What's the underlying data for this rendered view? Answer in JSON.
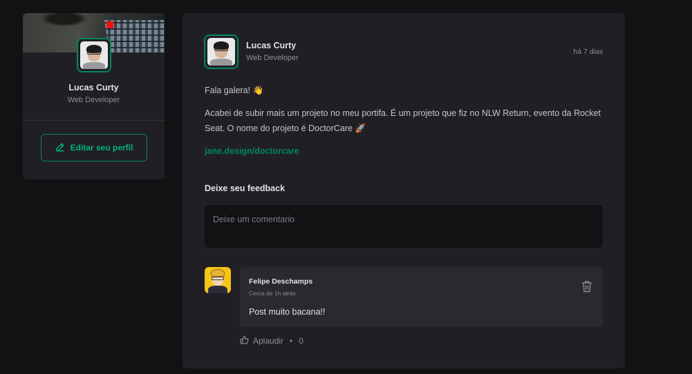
{
  "profile": {
    "name": "Lucas Curty",
    "role": "Web Developer",
    "edit_label": "Editar seu perfil"
  },
  "post": {
    "author_name": "Lucas Curty",
    "author_role": "Web Developer",
    "published": "há 7 dias",
    "paragraph_1": "Fala galera! 👋",
    "paragraph_2": "Acabei de subir mais um projeto no meu portifa. É um projeto que fiz no NLW Return, evento da Rocket Seat. O nome do projeto é DoctorCare 🚀",
    "link": "jane.design/doctorcare"
  },
  "feedback": {
    "title": "Deixe seu feedback",
    "placeholder": "Deixe um comentario"
  },
  "comment": {
    "author": "Felipe Deschamps",
    "time": "Cerca de 1h atrás",
    "text": "Post muito bacana!!",
    "applaud_label": "Aplaudir",
    "applaud_separator": "•",
    "applaud_count": "0"
  },
  "colors": {
    "accent": "#00875f",
    "accent_light": "#00b37e",
    "background": "#121214",
    "card": "#202024"
  }
}
